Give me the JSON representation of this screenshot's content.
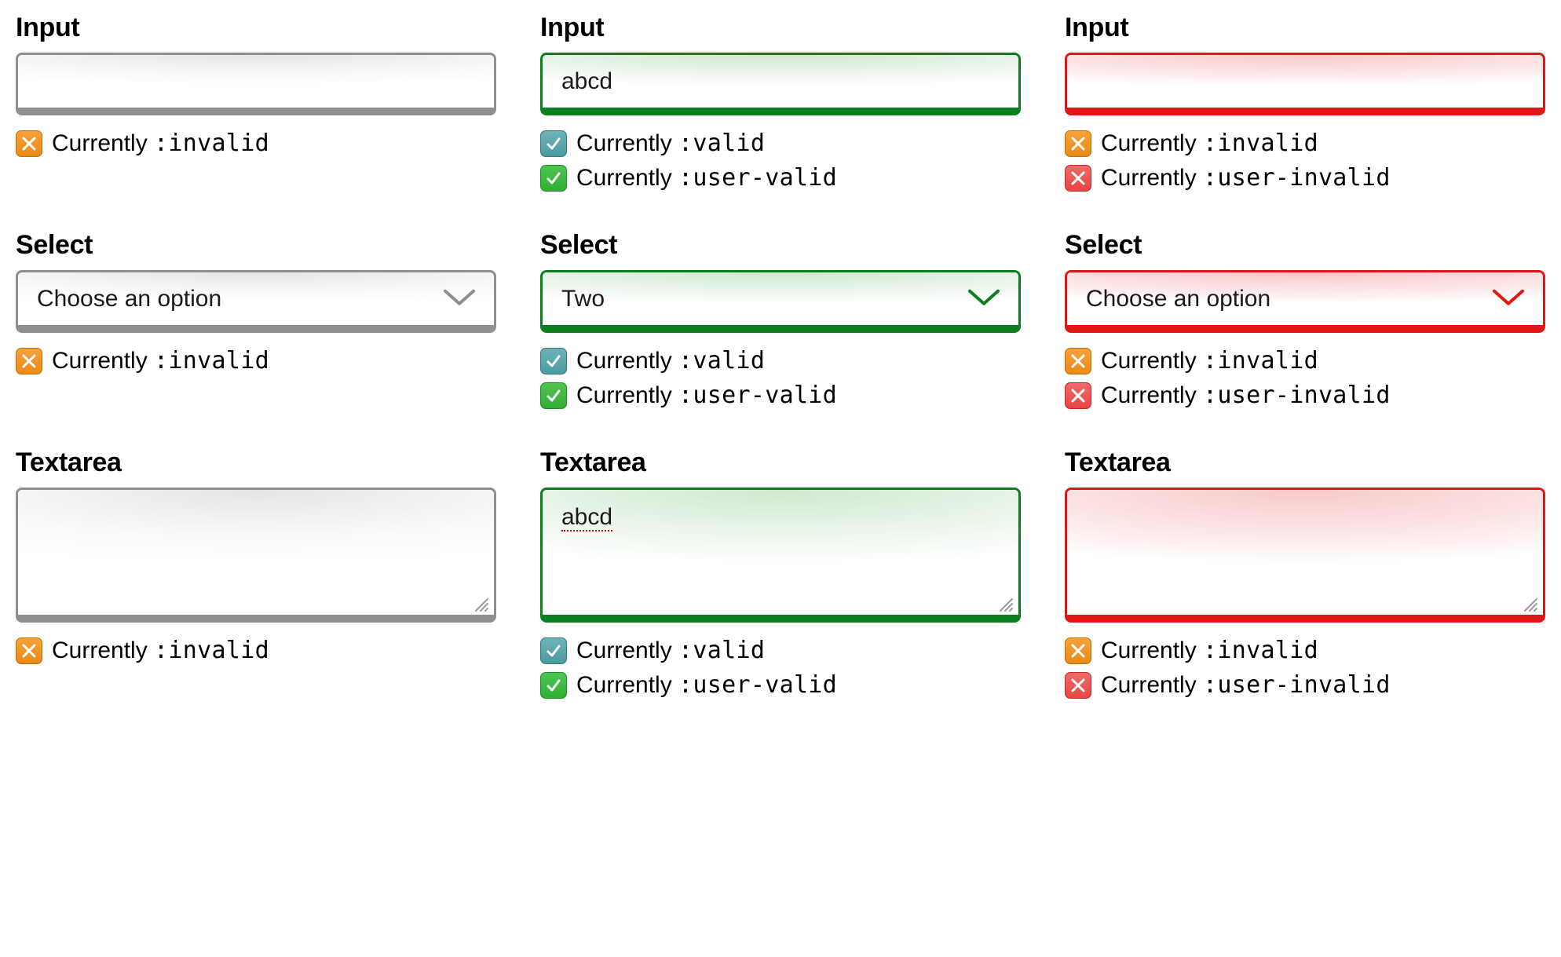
{
  "status_word": "Currently",
  "codes": {
    "invalid": ":invalid",
    "valid": ":valid",
    "user_valid": ":user-valid",
    "user_invalid": ":user-invalid"
  },
  "labels": {
    "input": "Input",
    "select": "Select",
    "textarea": "Textarea"
  },
  "columns": [
    {
      "state": "neutral",
      "input_value": "",
      "select_value": "Choose an option",
      "textarea_value": "",
      "status": [
        {
          "icon": "orange-x",
          "code_key": "invalid"
        }
      ]
    },
    {
      "state": "valid",
      "input_value": "abcd",
      "select_value": "Two",
      "textarea_value": "abcd",
      "status": [
        {
          "icon": "teal-check",
          "code_key": "valid"
        },
        {
          "icon": "green-check",
          "code_key": "user_valid"
        }
      ]
    },
    {
      "state": "invalid",
      "input_value": "",
      "select_value": "Choose an option",
      "textarea_value": "",
      "status": [
        {
          "icon": "orange-x",
          "code_key": "invalid"
        },
        {
          "icon": "red-x",
          "code_key": "user_invalid"
        }
      ]
    }
  ]
}
